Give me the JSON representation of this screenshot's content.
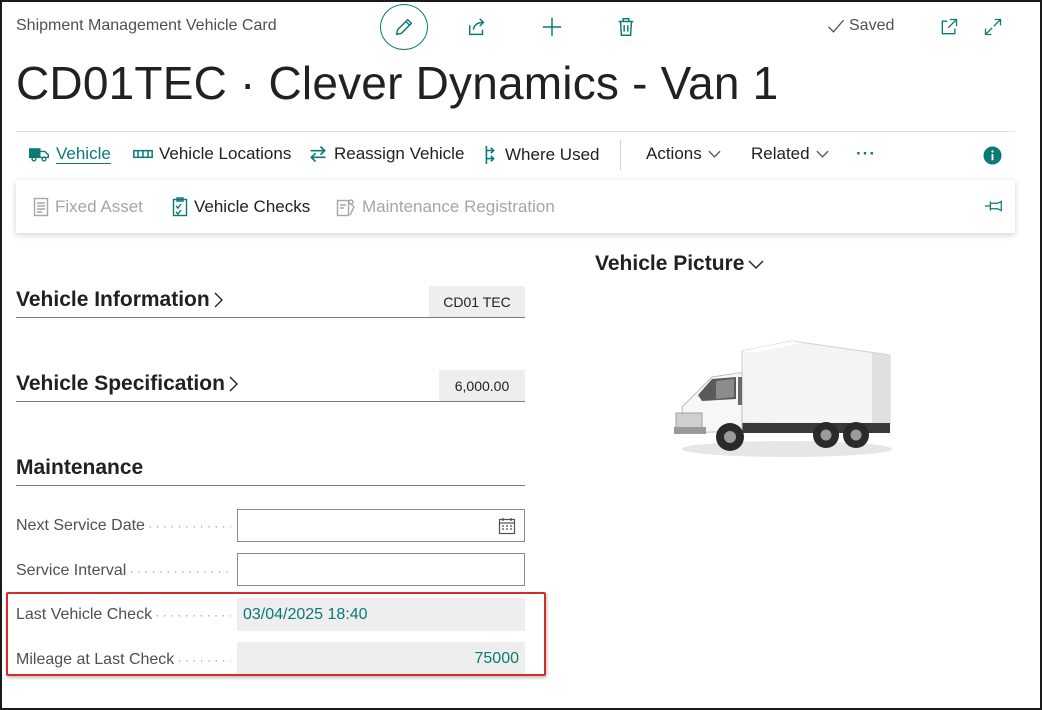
{
  "header": {
    "breadcrumb": "Shipment Management Vehicle Card",
    "saved_label": "Saved",
    "title": "CD01TEC · Clever Dynamics - Van 1"
  },
  "icons": {
    "edit": "pencil-icon",
    "share": "share-icon",
    "new": "plus-icon",
    "delete": "trash-icon",
    "saved": "check-icon",
    "open_new_window": "open-in-new-icon",
    "expand": "expand-icon",
    "info": "info-icon",
    "pin": "pin-icon"
  },
  "actionbar": {
    "items": [
      {
        "label": "Vehicle",
        "icon": "truck-icon"
      },
      {
        "label": "Vehicle Locations",
        "icon": "rail-icon"
      },
      {
        "label": "Reassign Vehicle",
        "icon": "swap-arrows-icon"
      },
      {
        "label": "Where Used",
        "icon": "tree-arrows-icon"
      }
    ],
    "menus": [
      {
        "label": "Actions"
      },
      {
        "label": "Related"
      }
    ],
    "more": "···"
  },
  "promoted": {
    "items": [
      {
        "label": "Fixed Asset",
        "icon": "document-icon",
        "enabled": false
      },
      {
        "label": "Vehicle Checks",
        "icon": "checklist-icon",
        "enabled": true
      },
      {
        "label": "Maintenance Registration",
        "icon": "wrench-registration-icon",
        "enabled": false
      }
    ]
  },
  "sections": {
    "vehicle_information": {
      "title": "Vehicle Information",
      "summary": "CD01 TEC"
    },
    "vehicle_specification": {
      "title": "Vehicle Specification",
      "summary": "6,000.00"
    },
    "maintenance": {
      "title": "Maintenance",
      "fields": [
        {
          "label": "Next Service Date",
          "value": ""
        },
        {
          "label": "Service Interval",
          "value": ""
        },
        {
          "label": "Last Vehicle Check",
          "value": "03/04/2025 18:40"
        },
        {
          "label": "Mileage at Last Check",
          "value": "75000"
        }
      ]
    },
    "vehicle_picture": {
      "title": "Vehicle Picture"
    }
  },
  "colors": {
    "accent": "#0b7a75",
    "highlight_border": "#d62b2b",
    "readonly_bg": "#eeeeee"
  }
}
